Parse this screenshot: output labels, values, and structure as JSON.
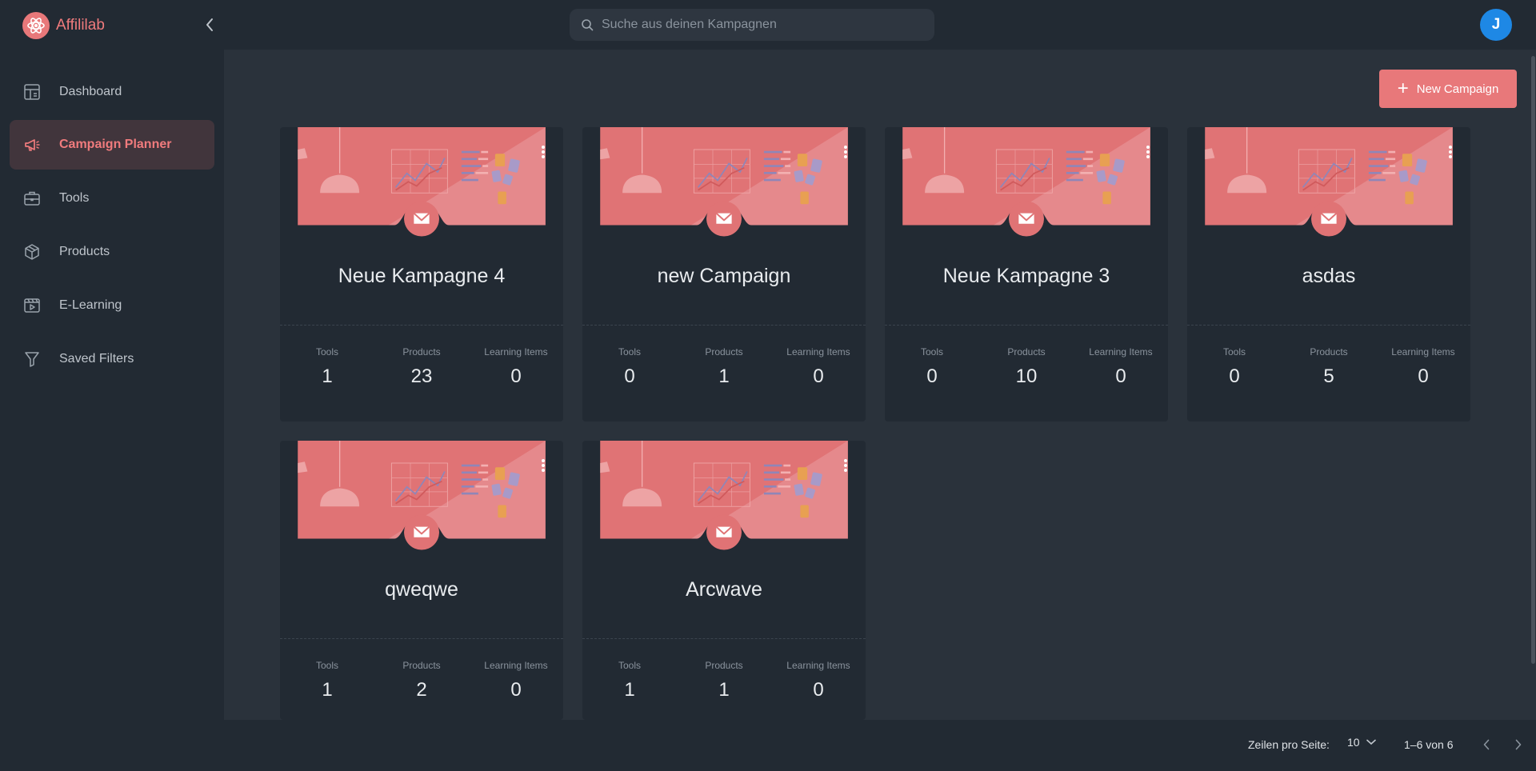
{
  "app": {
    "name": "Affililab",
    "avatar_initial": "J"
  },
  "search": {
    "placeholder": "Suche aus deinen Kampagnen"
  },
  "sidebar": {
    "items": [
      {
        "label": "Dashboard",
        "icon": "dashboard-icon"
      },
      {
        "label": "Campaign Planner",
        "icon": "megaphone-icon",
        "active": true
      },
      {
        "label": "Tools",
        "icon": "toolbox-icon"
      },
      {
        "label": "Products",
        "icon": "box-icon"
      },
      {
        "label": "E-Learning",
        "icon": "video-icon"
      },
      {
        "label": "Saved Filters",
        "icon": "filter-icon"
      }
    ]
  },
  "toolbar": {
    "new_campaign": "New Campaign"
  },
  "stat_labels": {
    "tools": "Tools",
    "products": "Products",
    "learning": "Learning Items"
  },
  "campaigns": [
    {
      "title": "Neue Kampagne 4",
      "tools": "1",
      "products": "23",
      "learning": "0"
    },
    {
      "title": "new Campaign",
      "tools": "0",
      "products": "1",
      "learning": "0"
    },
    {
      "title": "Neue Kampagne 3",
      "tools": "0",
      "products": "10",
      "learning": "0"
    },
    {
      "title": "asdas",
      "tools": "0",
      "products": "5",
      "learning": "0"
    },
    {
      "title": "qweqwe",
      "tools": "1",
      "products": "2",
      "learning": "0"
    },
    {
      "title": "Arcwave",
      "tools": "1",
      "products": "1",
      "learning": "0"
    }
  ],
  "pagination": {
    "rows_label": "Zeilen pro Seite:",
    "rows_value": "10",
    "range": "1–6 von 6"
  },
  "colors": {
    "accent": "#e8787a",
    "sidebar_bg": "#222a33",
    "main_bg": "#2a323b",
    "avatar": "#1e88e5"
  }
}
